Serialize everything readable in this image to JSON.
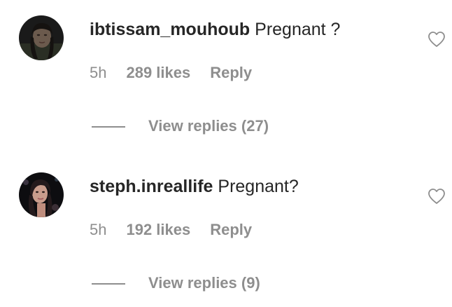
{
  "comments": [
    {
      "username": "ibtissam_mouhoub",
      "text": "Pregnant ?",
      "time": "5h",
      "likes": "289 likes",
      "reply_label": "Reply",
      "view_replies": "View replies (27)"
    },
    {
      "username": "steph.inreallife",
      "text": "Pregnant?",
      "time": "5h",
      "likes": "192 likes",
      "reply_label": "Reply",
      "view_replies": "View replies (9)"
    }
  ],
  "icons": {
    "like": "heart-outline-icon",
    "avatar": "user-avatar"
  },
  "colors": {
    "primary_text": "#262626",
    "secondary_text": "#8e8e8e",
    "background": "#ffffff"
  }
}
